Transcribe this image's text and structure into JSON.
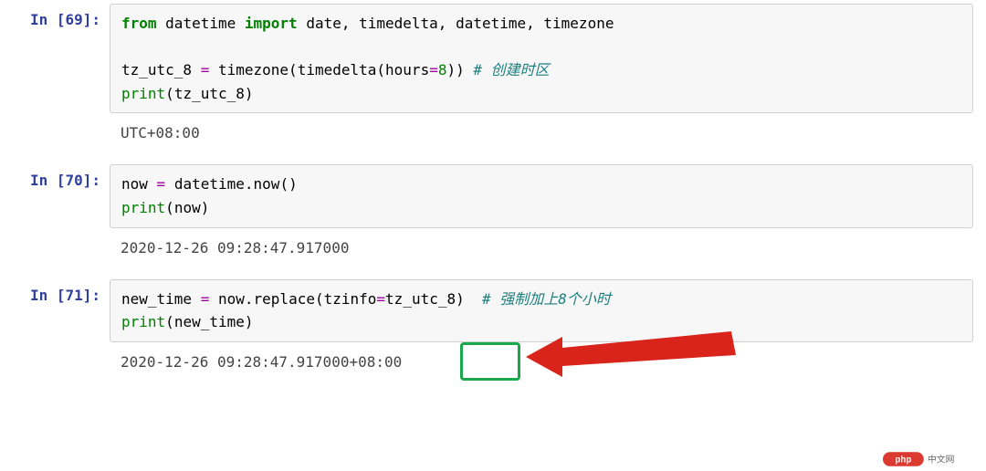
{
  "cells": [
    {
      "prompt": "In [69]:",
      "code": {
        "l1_from": "from",
        "l1_mod": "datetime",
        "l1_import": "import",
        "l1_names": "date, timedelta, datetime, timezone",
        "l3_lhs": "tz_utc_8",
        "l3_eq": "=",
        "l3_callA": "timezone",
        "l3_lp1": "(",
        "l3_callB": "timedelta",
        "l3_lp2": "(",
        "l3_kwarg": "hours",
        "l3_kweq": "=",
        "l3_num": "8",
        "l3_rp": "))",
        "l3_comment": "# 创建时区",
        "l4_print": "print",
        "l4_lp": "(",
        "l4_arg": "tz_utc_8",
        "l4_rp": ")"
      },
      "output": "UTC+08:00"
    },
    {
      "prompt": "In [70]:",
      "code": {
        "l1_lhs": "now",
        "l1_eq": "=",
        "l1_obj": "datetime",
        "l1_dot": ".",
        "l1_meth": "now",
        "l1_paren": "()",
        "l2_print": "print",
        "l2_lp": "(",
        "l2_arg": "now",
        "l2_rp": ")"
      },
      "output": "2020-12-26 09:28:47.917000"
    },
    {
      "prompt": "In [71]:",
      "code": {
        "l1_lhs": "new_time",
        "l1_eq": "=",
        "l1_obj": "now",
        "l1_dot": ".",
        "l1_meth": "replace",
        "l1_lp": "(",
        "l1_kwarg": "tzinfo",
        "l1_kweq": "=",
        "l1_val": "tz_utc_8",
        "l1_rp": ")",
        "l1_comment": "# 强制加上8个小时",
        "l2_print": "print",
        "l2_lp": "(",
        "l2_arg": "new_time",
        "l2_rp": ")"
      },
      "output_pre": "2020-12-26 09:28:47.917000",
      "output_tz": "+08:00"
    }
  ],
  "watermark": {
    "brand": "php",
    "text": "中文网"
  }
}
